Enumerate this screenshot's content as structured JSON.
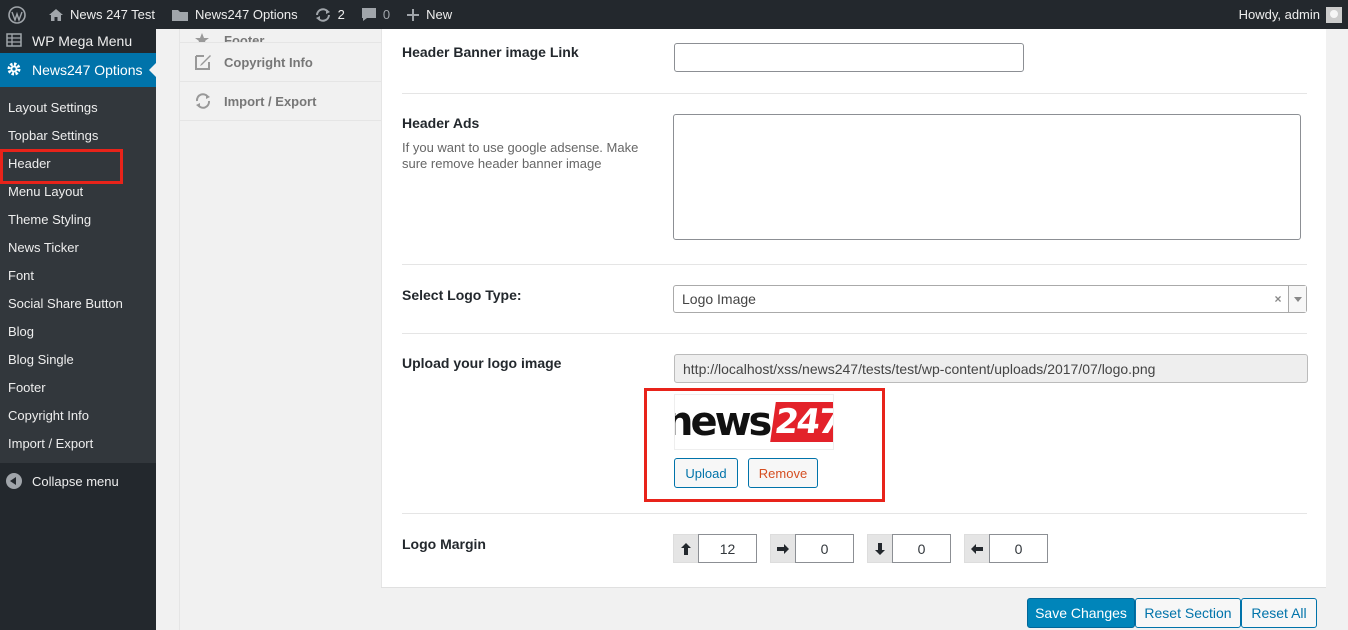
{
  "adminbar": {
    "site_name": "News 247 Test",
    "options_link": "News247 Options",
    "updates_count": "2",
    "comments_count": "0",
    "new_label": "New",
    "howdy": "Howdy, admin",
    "icons": [
      "wordpress-logo-icon",
      "home-icon",
      "folder-icon",
      "refresh-icon",
      "comment-icon",
      "plus-icon"
    ]
  },
  "sidebar": {
    "mega_menu": "WP Mega Menu",
    "current": "News247 Options",
    "items": [
      {
        "label": "Layout Settings"
      },
      {
        "label": "Topbar Settings"
      },
      {
        "label": "Header"
      },
      {
        "label": "Menu Layout"
      },
      {
        "label": "Theme Styling"
      },
      {
        "label": "News Ticker"
      },
      {
        "label": "Font"
      },
      {
        "label": "Social Share Button"
      },
      {
        "label": "Blog"
      },
      {
        "label": "Blog Single"
      },
      {
        "label": "Footer"
      },
      {
        "label": "Copyright Info"
      },
      {
        "label": "Import / Export"
      }
    ],
    "collapse": "Collapse menu"
  },
  "panel_nav": {
    "items": [
      {
        "label": "Footer",
        "icon": "star-icon"
      },
      {
        "label": "Copyright Info",
        "icon": "edit-icon"
      },
      {
        "label": "Import / Export",
        "icon": "refresh-icon"
      }
    ]
  },
  "fields": {
    "banner_link": {
      "label": "Header Banner image Link",
      "value": ""
    },
    "header_ads": {
      "label": "Header Ads",
      "desc": "If you want to use google adsense. Make sure remove header banner image",
      "value": ""
    },
    "logo_type": {
      "label": "Select Logo Type:",
      "value": "Logo Image",
      "clear": "×"
    },
    "logo_upload": {
      "label": "Upload your logo image",
      "url": "http://localhost/xss/news247/tests/test/wp-content/uploads/2017/07/logo.png",
      "preview_text_1": "news",
      "preview_text_2": "247",
      "upload": "Upload",
      "remove": "Remove"
    },
    "logo_margin": {
      "label": "Logo Margin",
      "top": "12",
      "right": "0",
      "bottom": "0",
      "left": "0"
    }
  },
  "footer": {
    "save": "Save Changes",
    "reset_section": "Reset Section",
    "reset_all": "Reset All"
  },
  "colors": {
    "accent": "#0073aa",
    "highlight": "#e8231a",
    "logo_red": "#e3222a"
  }
}
